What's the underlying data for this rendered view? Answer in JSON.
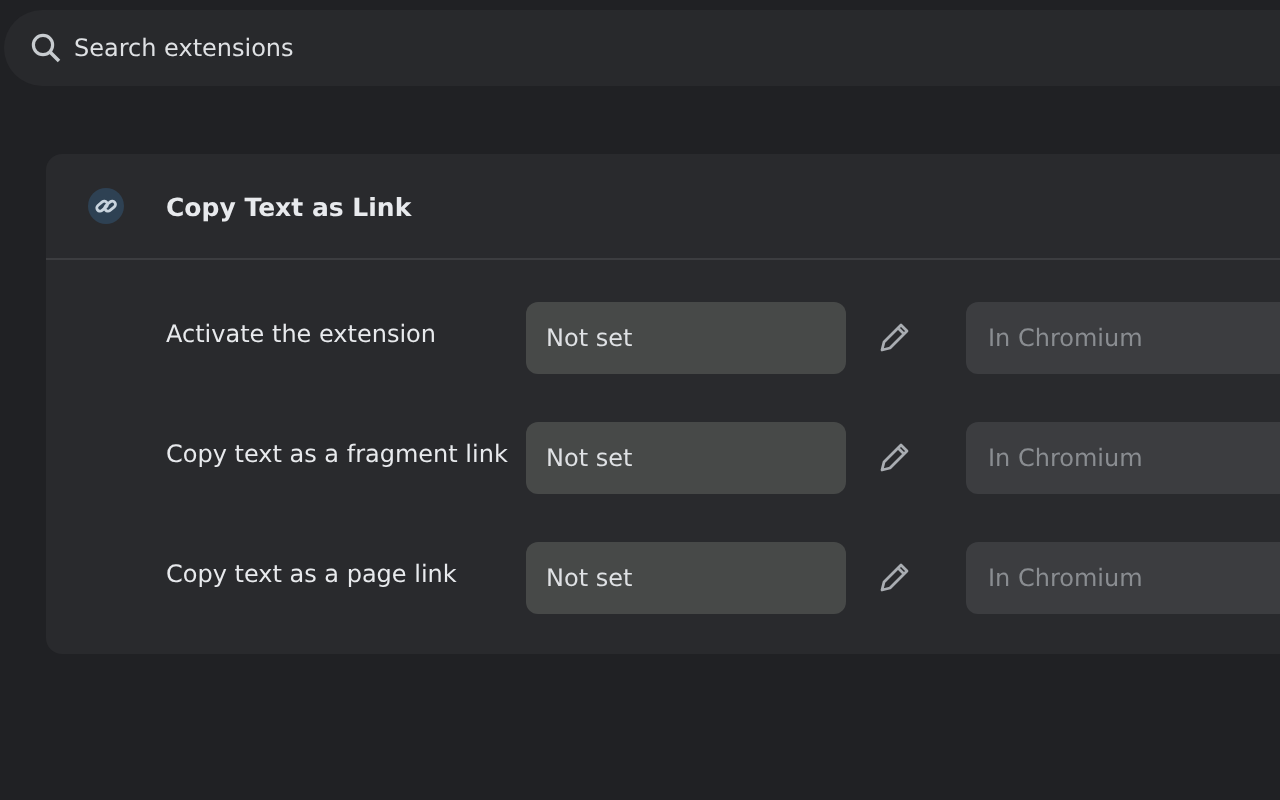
{
  "search": {
    "placeholder": "Search extensions"
  },
  "extension": {
    "name": "Copy Text as Link",
    "shortcuts": [
      {
        "label": "Activate the extension",
        "shortcut": "Not set",
        "scope": "In Chromium"
      },
      {
        "label": "Copy text as a fragment link",
        "shortcut": "Not set",
        "scope": "In Chromium"
      },
      {
        "label": "Copy text as a page link",
        "shortcut": "Not set",
        "scope": "In Chromium"
      }
    ]
  }
}
